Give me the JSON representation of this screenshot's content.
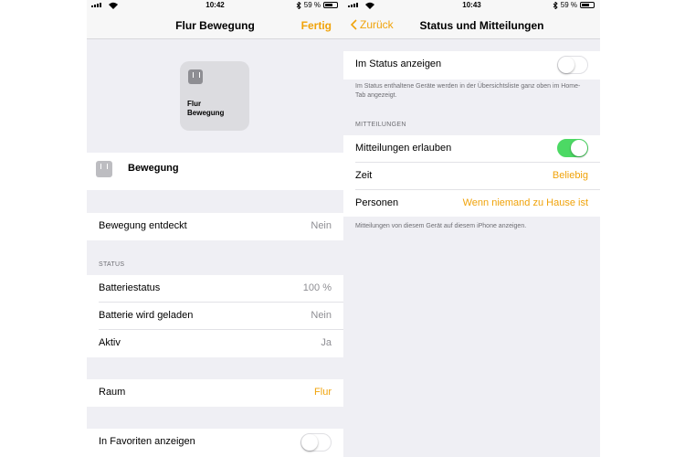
{
  "left": {
    "status": {
      "time": "10:42",
      "battery": "59 %"
    },
    "nav": {
      "title": "Flur Bewegung",
      "action": "Fertig"
    },
    "tile": {
      "name_line1": "Flur",
      "name_line2": "Bewegung"
    },
    "accessory": {
      "name": "Bewegung"
    },
    "motion": {
      "label": "Bewegung entdeckt",
      "value": "Nein"
    },
    "status_section": {
      "header": "STATUS",
      "rows": [
        {
          "label": "Batteriestatus",
          "value": "100 %"
        },
        {
          "label": "Batterie wird geladen",
          "value": "Nein"
        },
        {
          "label": "Aktiv",
          "value": "Ja"
        }
      ]
    },
    "room": {
      "label": "Raum",
      "value": "Flur"
    },
    "favorites": {
      "label": "In Favoriten anzeigen",
      "on": false
    }
  },
  "right": {
    "status": {
      "time": "10:43",
      "battery": "59 %"
    },
    "nav": {
      "back": "Zurück",
      "title": "Status und Mitteilungen"
    },
    "show_in_status": {
      "label": "Im Status anzeigen",
      "on": false
    },
    "status_note": "Im Status enthaltene Geräte werden in der Übersichtsliste ganz oben im Home-Tab angezeigt.",
    "notifications": {
      "header": "MITTEILUNGEN",
      "allow": {
        "label": "Mitteilungen erlauben",
        "on": true
      },
      "time": {
        "label": "Zeit",
        "value": "Beliebig"
      },
      "people": {
        "label": "Personen",
        "value": "Wenn niemand zu Hause ist"
      },
      "note": "Mitteilungen von diesem Gerät auf diesem iPhone anzeigen."
    }
  },
  "colors": {
    "accent": "#f0a30a",
    "toggle_on": "#4cd964",
    "background": "#efeff4"
  },
  "battery_level": 0.59
}
